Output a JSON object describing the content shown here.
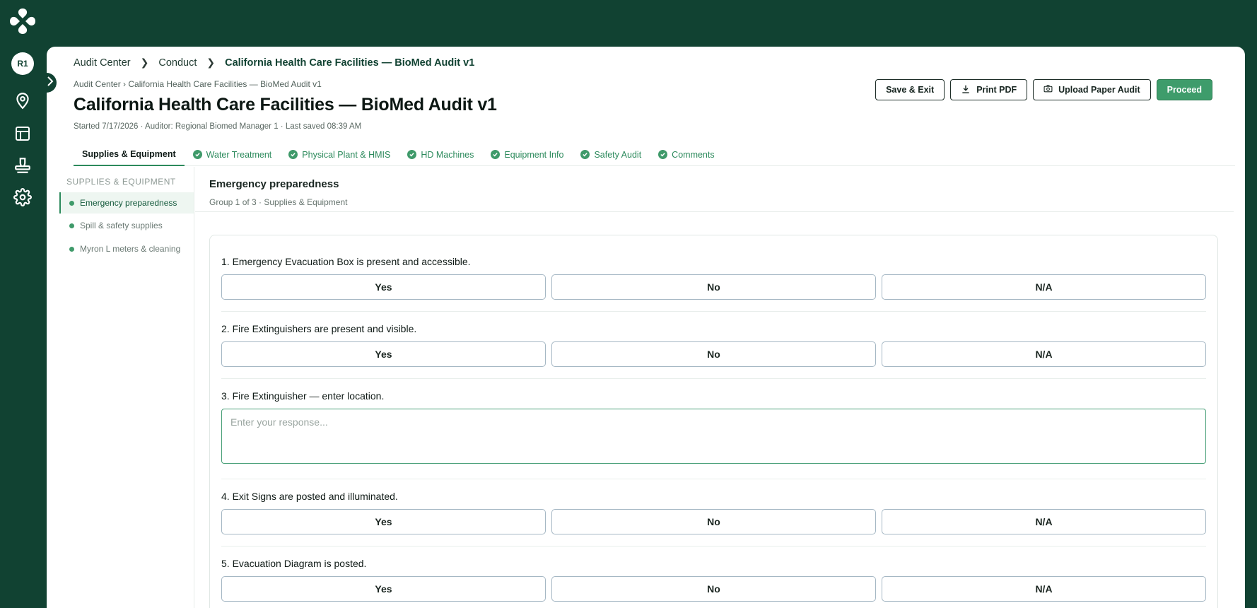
{
  "rail": {
    "avatar": "R1",
    "icons": [
      "logo-icon",
      "location-pin-icon",
      "table-icon",
      "stamp-icon",
      "gear-icon",
      "chevron-right-icon"
    ]
  },
  "breadcrumb": {
    "items": [
      "Audit Center",
      "Conduct",
      "California Health Care Facilities — BioMed Audit v1"
    ]
  },
  "header": {
    "subcrumb": "Audit Center › California Health Care Facilities — BioMed Audit v1",
    "title": "California Health Care Facilities — BioMed Audit v1",
    "meta": "Started 7/17/2026 · Auditor: Regional Biomed Manager 1 · Last saved 08:39 AM"
  },
  "actions": {
    "save_exit": "Save & Exit",
    "print_pdf": "Print PDF",
    "upload_paper": "Upload Paper Audit",
    "proceed": "Proceed"
  },
  "tabs": [
    {
      "label": "Supplies & Equipment",
      "active": true,
      "done": false
    },
    {
      "label": "Water Treatment",
      "active": false,
      "done": true
    },
    {
      "label": "Physical Plant & HMIS",
      "active": false,
      "done": true
    },
    {
      "label": "HD Machines",
      "active": false,
      "done": true
    },
    {
      "label": "Equipment Info",
      "active": false,
      "done": true
    },
    {
      "label": "Safety Audit",
      "active": false,
      "done": true
    },
    {
      "label": "Comments",
      "active": false,
      "done": true
    }
  ],
  "subsidebar": {
    "heading": "SUPPLIES & EQUIPMENT",
    "items": [
      "Emergency preparedness",
      "Spill & safety supplies",
      "Myron L meters & cleaning"
    ]
  },
  "group": {
    "title": "Emergency preparedness",
    "subtitle": "Group 1 of 3 · Supplies & Equipment"
  },
  "questions": {
    "q1": "1. Emergency Evacuation Box is present and accessible.",
    "q2": "2. Fire Extinguishers are present and visible.",
    "q3": "3. Fire Extinguisher — enter location.",
    "q3_placeholder": "Enter your response...",
    "q4": "4. Exit Signs are posted and illuminated.",
    "q5": "5. Evacuation Diagram is posted."
  },
  "options": {
    "yes": "Yes",
    "no": "No",
    "na": "N/A"
  },
  "colors": {
    "brand": "#114232",
    "accent": "#3e9c6b",
    "tab_text": "#2c8a5c"
  }
}
